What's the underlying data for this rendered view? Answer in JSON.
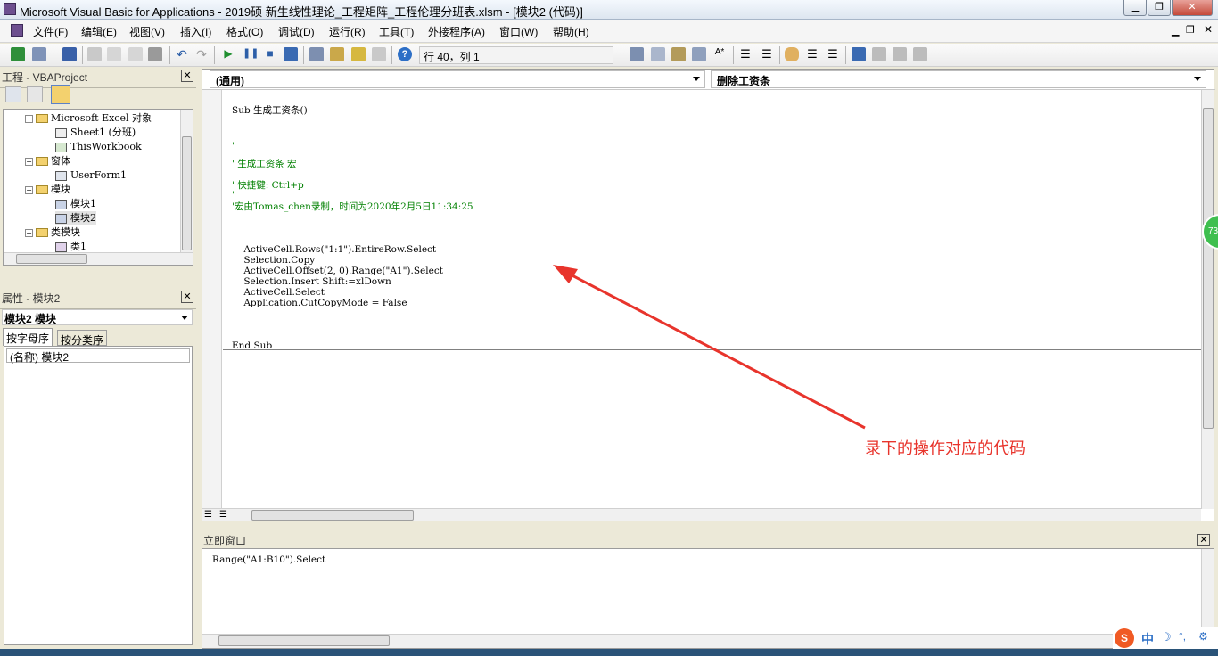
{
  "window": {
    "title": "Microsoft Visual Basic for Applications - 2019硕 新生线性理论_工程矩阵_工程伦理分班表.xlsm - [模块2 (代码)]"
  },
  "menu": [
    "文件(F)",
    "编辑(E)",
    "视图(V)",
    "插入(I)",
    "格式(O)",
    "调试(D)",
    "运行(R)",
    "工具(T)",
    "外接程序(A)",
    "窗口(W)",
    "帮助(H)"
  ],
  "toolbar": {
    "cursor_position": "行 40，列 1"
  },
  "project": {
    "title": "工程 - VBAProject",
    "tree": [
      "Microsoft Excel 对象",
      "Sheet1 (分班)",
      "ThisWorkbook",
      "窗体",
      "UserForm1",
      "模块",
      "模块1",
      "模块2",
      "类模块",
      "类1"
    ]
  },
  "properties": {
    "title": "属性 - 模块2",
    "object": "模块2 模块",
    "tabs": [
      "按字母序",
      "按分类序"
    ],
    "rows": [
      "(名称) 模块2"
    ]
  },
  "code": {
    "object_combo": "(通用)",
    "proc_combo": "删除工资条",
    "lines": [
      "Sub 生成工资条()",
      "'",
      "' 生成工资条 宏",
      "' 快捷键: Ctrl+p",
      "'",
      "'宏由Tomas_chen录制，时间为2020年2月5日11:34:25",
      "    ActiveCell.Rows(\"1:1\").EntireRow.Select",
      "    Selection.Copy",
      "    ActiveCell.Offset(2, 0).Range(\"A1\").Select",
      "    Selection.Insert Shift:=xlDown",
      "    ActiveCell.Select",
      "    Application.CutCopyMode = False",
      "End Sub"
    ]
  },
  "immediate": {
    "title": "立即窗口",
    "lines": [
      "Range(\"A1:B10\").Select"
    ]
  },
  "annotation": {
    "text": "录下的操作对应的代码",
    "color": "#e8342c"
  },
  "tray": {
    "ime": "中",
    "badge": "73"
  }
}
